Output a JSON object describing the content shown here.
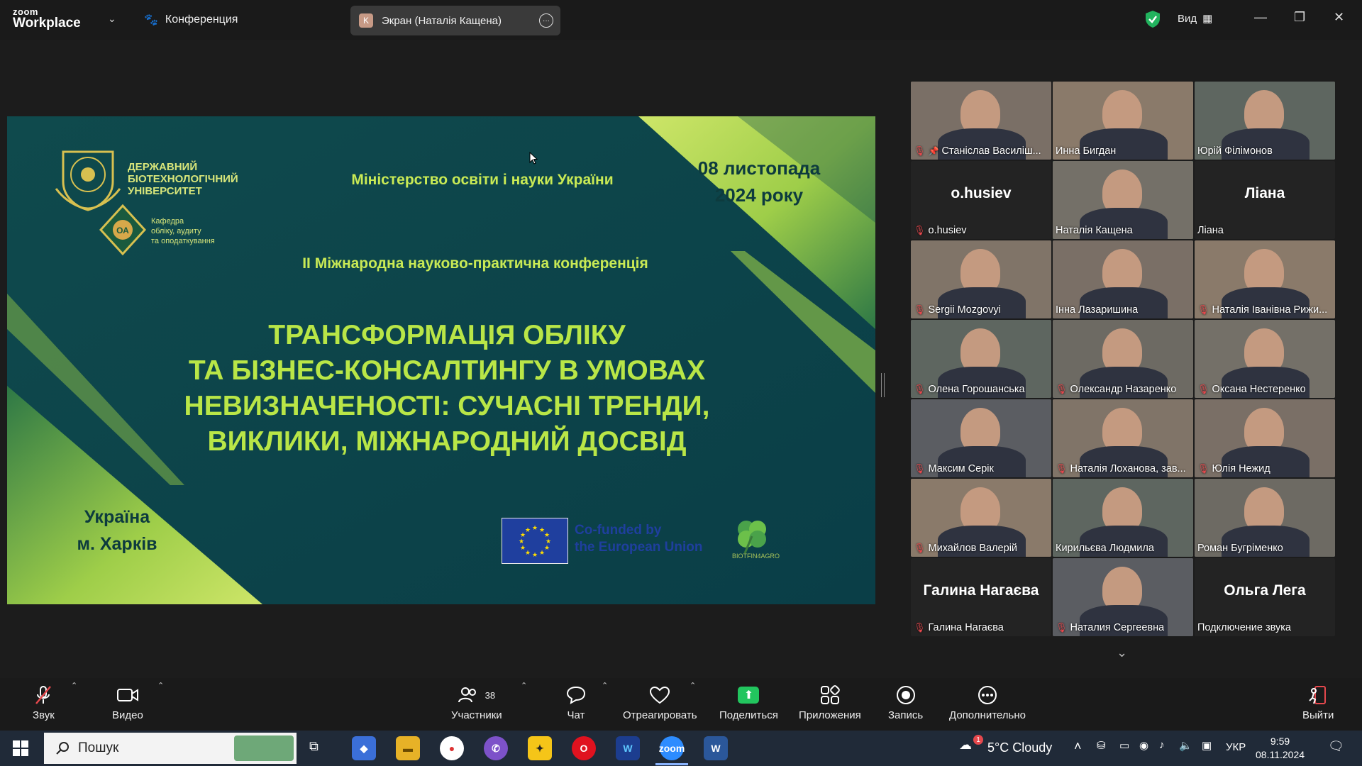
{
  "titlebar": {
    "brand_small": "zoom",
    "brand_large": "Workplace",
    "conference_label": "Конференция",
    "screen_share_initial": "K",
    "screen_share_title": "Экран (Наталія Кащена)",
    "view_label": "Вид"
  },
  "slide": {
    "university": "ДЕРЖАВНИЙ БІОТЕХНОЛОГІЧНИЙ УНІВЕРСИТЕТ",
    "university_line1": "ДЕРЖАВНИЙ",
    "university_line2": "БІОТЕХНОЛОГІЧНИЙ",
    "university_line3": "УНІВЕРСИТЕТ",
    "department_line1": "Кафедра",
    "department_line2": "обліку, аудиту",
    "department_line3": "та оподаткування",
    "ministry": "Міністерство освіти і науки України",
    "date_line1": "08 листопада",
    "date_line2": "2024 року",
    "conference": "II Міжнародна науково-практична конференція",
    "title_line1": "ТРАНСФОРМАЦІЯ ОБЛІКУ",
    "title_line2": "ТА БІЗНЕС-КОНСАЛТИНГУ В УМОВАХ",
    "title_line3": "НЕВИЗНАЧЕНОСТІ: СУЧАСНІ ТРЕНДИ,",
    "title_line4": "ВИКЛИКИ, МІЖНАРОДНИЙ ДОСВІД",
    "place_line1": "Україна",
    "place_line2": "м. Харків",
    "eu_line1": "Co-funded by",
    "eu_line2": "the European Union",
    "partner_label": "BIOTFIN4AGRO"
  },
  "gallery": {
    "tiles": [
      {
        "name": "Станіслав Василіш...",
        "muted": true,
        "pinned": true,
        "video": true
      },
      {
        "name": "Инна Бигдан",
        "muted": false,
        "video": true
      },
      {
        "name": "Юрій Філімонов",
        "muted": false,
        "video": true
      },
      {
        "name": "o.husiev",
        "muted": true,
        "video": false,
        "big": "o.husiev"
      },
      {
        "name": "Наталія Кащена",
        "muted": false,
        "video": true,
        "active": true
      },
      {
        "name": "Ліана",
        "muted": false,
        "video": false,
        "big": "Ліана"
      },
      {
        "name": "Sergii Mozgovyi",
        "muted": true,
        "video": true
      },
      {
        "name": "Інна Лазаришина",
        "muted": false,
        "video": true
      },
      {
        "name": "Наталія Іванівна Рижи...",
        "muted": true,
        "video": true
      },
      {
        "name": "Олена Горошанська",
        "muted": true,
        "video": true
      },
      {
        "name": "Олександр Назаренко",
        "muted": true,
        "video": true
      },
      {
        "name": "Оксана Нестеренко",
        "muted": true,
        "video": true
      },
      {
        "name": "Максим Серік",
        "muted": true,
        "video": true
      },
      {
        "name": "Наталія Лоханова, зав...",
        "muted": true,
        "video": true
      },
      {
        "name": "Юлія Нежид",
        "muted": true,
        "video": true
      },
      {
        "name": "Михайлов Валерій",
        "muted": true,
        "video": true
      },
      {
        "name": "Кирильєва Людмила",
        "muted": false,
        "video": true
      },
      {
        "name": "Роман Бугріменко",
        "muted": false,
        "video": true
      },
      {
        "name": "Галина Нагаєва",
        "muted": true,
        "video": false,
        "big": "Галина Нагаєва"
      },
      {
        "name": "Наталия Сергеевна",
        "muted": true,
        "video": true
      },
      {
        "name": "Подключение звука",
        "muted": false,
        "video": false,
        "big": "Ольга Лега"
      }
    ]
  },
  "toolbar": {
    "audio": "Звук",
    "video": "Видео",
    "participants": "Участники",
    "participants_count": "38",
    "chat": "Чат",
    "react": "Отреагировать",
    "share": "Поделиться",
    "apps": "Приложения",
    "record": "Запись",
    "more": "Дополнительно",
    "leave": "Выйти"
  },
  "taskbar": {
    "search_placeholder": "Пошук",
    "weather": "5°C  Cloudy",
    "weather_badge": "1",
    "lang": "УКР",
    "time": "9:59",
    "date": "08.11.2024"
  },
  "colors": {
    "slide_bg": "#0f4a4d",
    "slide_accent": "#c9ea55",
    "active_speaker": "#21c37c",
    "mute_red": "#e5484d",
    "share_green": "#22c55e"
  }
}
